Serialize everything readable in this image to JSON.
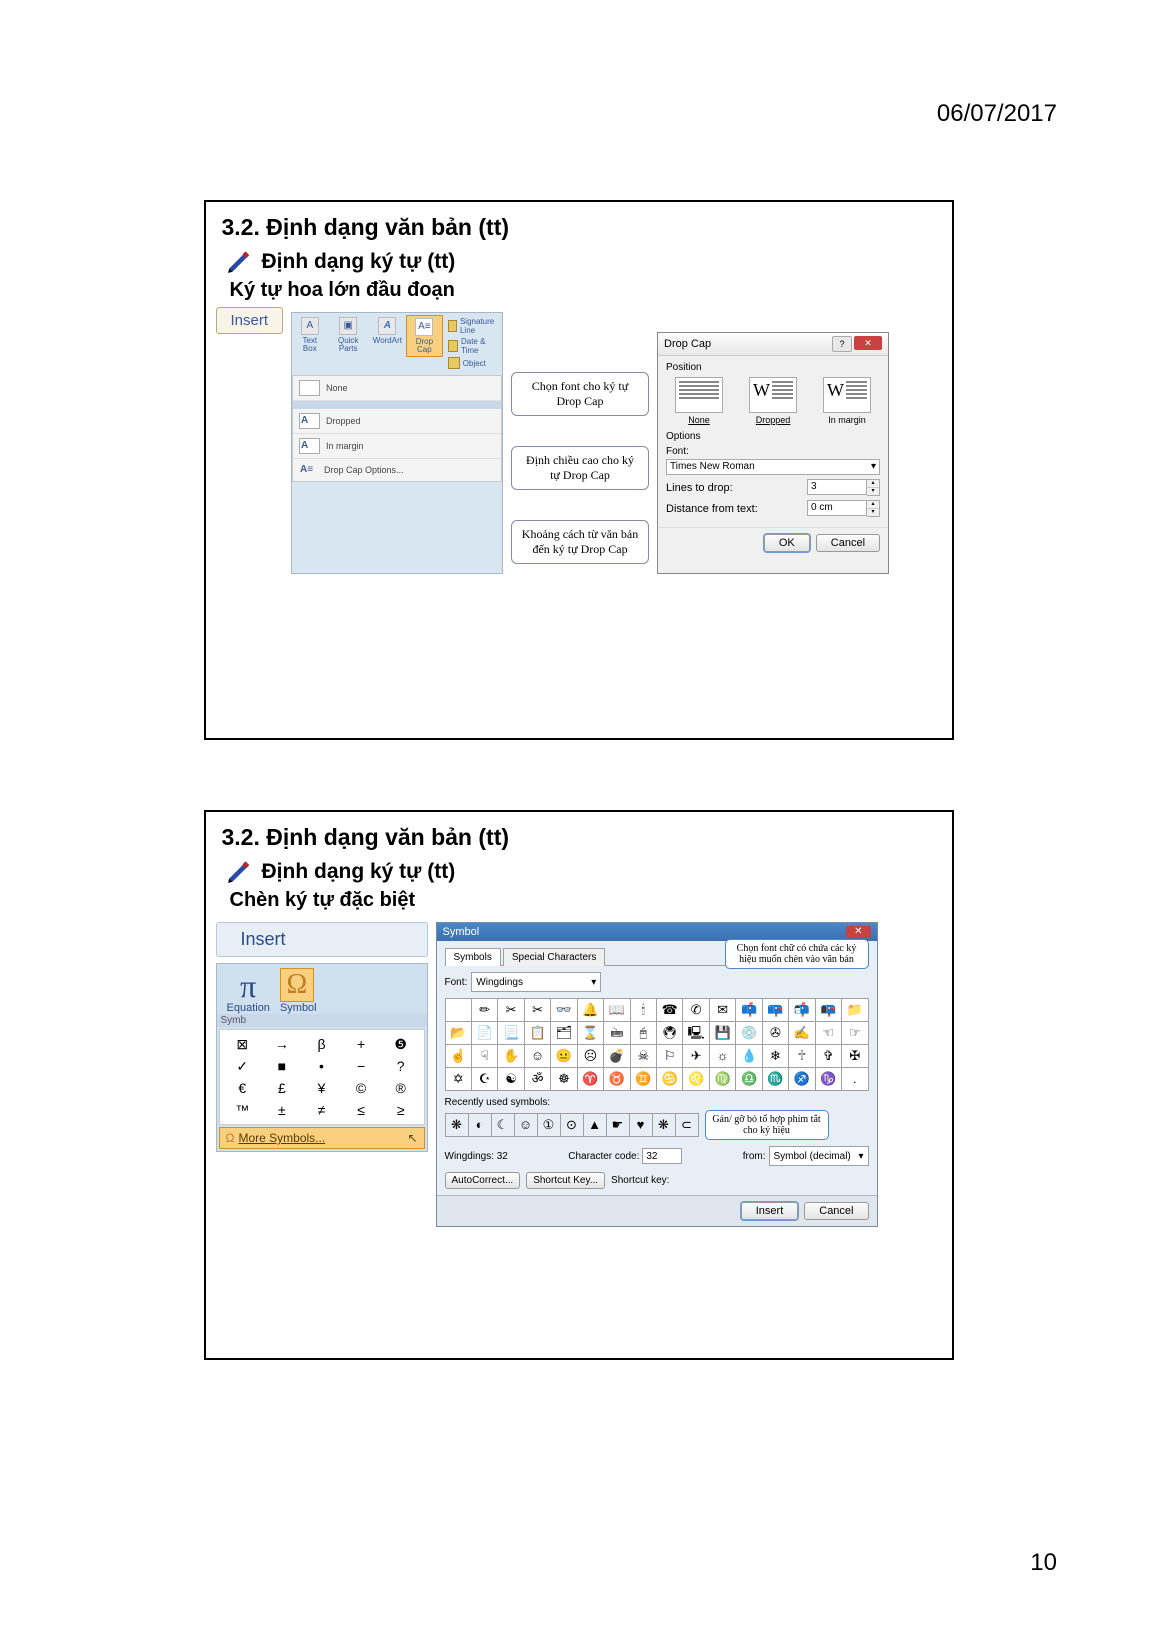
{
  "page": {
    "date": "06/07/2017",
    "number": "10"
  },
  "slide1": {
    "title": "3.2. Định dạng văn bản (tt)",
    "subtitle": "Định dạng ký tự (tt)",
    "subhead": "Ký tự hoa lớn đầu đoạn",
    "insert_tab": "Insert",
    "ribbon": {
      "text_box": "Text Box",
      "quick_parts": "Quick Parts",
      "wordart": "WordArt",
      "drop_cap": "Drop Cap",
      "signature": "Signature Line",
      "date_time": "Date & Time",
      "object": "Object"
    },
    "menu": {
      "none": "None",
      "dropped": "Dropped",
      "in_margin": "In margin",
      "options": "Drop Cap Options..."
    },
    "callouts": {
      "font": "Chọn font cho ký tự Drop Cap",
      "height": "Định chiều cao cho ký tự Drop Cap",
      "distance": "Khoảng cách từ văn bản đến ký tự Drop Cap"
    },
    "dialog": {
      "title": "Drop Cap",
      "position_label": "Position",
      "pos_none": "None",
      "pos_dropped": "Dropped",
      "pos_inmargin": "In margin",
      "options_label": "Options",
      "font_label": "Font:",
      "font_value": "Times New Roman",
      "lines_label": "Lines to drop:",
      "lines_value": "3",
      "distance_label": "Distance from text:",
      "distance_value": "0 cm",
      "ok": "OK",
      "cancel": "Cancel"
    }
  },
  "slide2": {
    "title": "3.2. Định dạng văn bản (tt)",
    "subtitle": "Định dạng ký tự (tt)",
    "subhead": "Chèn ký tự đặc biệt",
    "insert_tab": "Insert",
    "equation": "Equation",
    "symbol": "Symbol",
    "symb_group": "Symb",
    "more_symbols": "More Symbols...",
    "grid": [
      "⊠",
      "→",
      "β",
      "+",
      "❺",
      "✓",
      "■",
      "•",
      "−",
      "?",
      "€",
      "£",
      "¥",
      "©",
      "®",
      "™",
      "±",
      "≠",
      "≤",
      "≥"
    ],
    "callouts": {
      "font": "Chọn font chữ có chứa các ký hiệu muốn chèn vào văn bản",
      "shortcut": "Gán/ gỡ bỏ tổ hợp phím tắt cho ký hiệu"
    },
    "dialog": {
      "title": "Symbol",
      "tab_symbols": "Symbols",
      "tab_special": "Special Characters",
      "font_label": "Font:",
      "font_value": "Wingdings",
      "grid_rows": [
        [
          "",
          "✏",
          "✂",
          "✂",
          "👓",
          "🔔",
          "📖",
          "🕯",
          "☎",
          "✆",
          "✉",
          "📫",
          "📪",
          "📬",
          "📭",
          "📁"
        ],
        [
          "📂",
          "📄",
          "📃",
          "📋",
          "🗂",
          "⌛",
          "🖮",
          "🖰",
          "🖲",
          "🖳",
          "💾",
          "💿",
          "✇",
          "✍",
          "☜",
          "☞"
        ],
        [
          "☝",
          "☟",
          "✋",
          "☺",
          "😐",
          "☹",
          "💣",
          "☠",
          "⚐",
          "✈",
          "☼",
          "💧",
          "❄",
          "🕆",
          "✞",
          "✠"
        ],
        [
          "✡",
          "☪",
          "☯",
          "ॐ",
          "☸",
          "♈",
          "♉",
          "♊",
          "♋",
          "♌",
          "♍",
          "♎",
          "♏",
          "♐",
          "♑",
          "."
        ]
      ],
      "recent_label": "Recently used symbols:",
      "recent": [
        "❋",
        "◐",
        "☾",
        "☺",
        "①",
        "⊙",
        "▲",
        "☛",
        "♥",
        "❋",
        "⊂"
      ],
      "name_label": "Wingdings: 32",
      "code_label": "Character code:",
      "code_value": "32",
      "from_label": "from:",
      "from_value": "Symbol (decimal)",
      "autocorrect": "AutoCorrect...",
      "shortcut_key": "Shortcut Key...",
      "shortcut_label": "Shortcut key:",
      "insert": "Insert",
      "cancel": "Cancel"
    }
  }
}
